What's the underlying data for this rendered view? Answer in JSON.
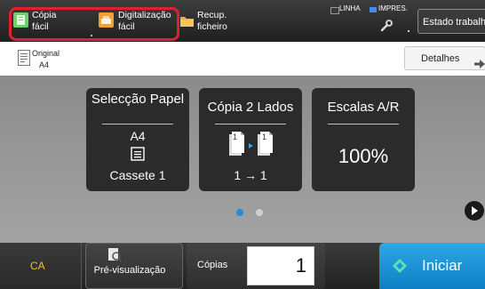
{
  "topbar": {
    "items": [
      {
        "line1": "Cópia",
        "line2": "fácil"
      },
      {
        "line1": "Digitalização",
        "line2": "fácil"
      },
      {
        "line1": "Recup.",
        "line2": "ficheiro"
      }
    ],
    "status": {
      "line_label": "LINHA",
      "print_label": "IMPRES."
    },
    "job_status_button": "Estado trabalho"
  },
  "original": {
    "label": "Original",
    "size": "A4"
  },
  "details_button": "Detalhes",
  "tiles": {
    "paper": {
      "title": "Selecção Papel",
      "size": "A4",
      "tray": "Cassete 1"
    },
    "duplex": {
      "title": "Cópia 2 Lados",
      "page_left": "1",
      "page_right": "1",
      "mode": "1 → 1"
    },
    "scale": {
      "title": "Escalas A/R",
      "value": "100%"
    }
  },
  "pager": {
    "pages": 2,
    "current": 1
  },
  "bottom": {
    "ca_label": "CA",
    "preview_label": "Pré-visualização",
    "copies_label": "Cópias",
    "copies_value": "1",
    "start_label": "Iniciar"
  },
  "colors": {
    "highlight": "#e0202e",
    "start": "#1a96d8",
    "ca": "#f0c419",
    "pager_active": "#1e8fe0",
    "pager_inactive": "#cfcfcf",
    "line_status": "#555555",
    "print_status": "#3b8ff0"
  },
  "icons": {
    "topbar": [
      "copy-icon",
      "scan-icon",
      "folder-icon",
      "wrench-icon"
    ],
    "original": "document-icon",
    "details": "arrow-right-icon",
    "paper": "paper-tray-icon",
    "duplex": "duplex-pages-icon",
    "next": "play-icon",
    "preview": "preview-magnifier-icon",
    "start": "start-diamond-icon"
  }
}
